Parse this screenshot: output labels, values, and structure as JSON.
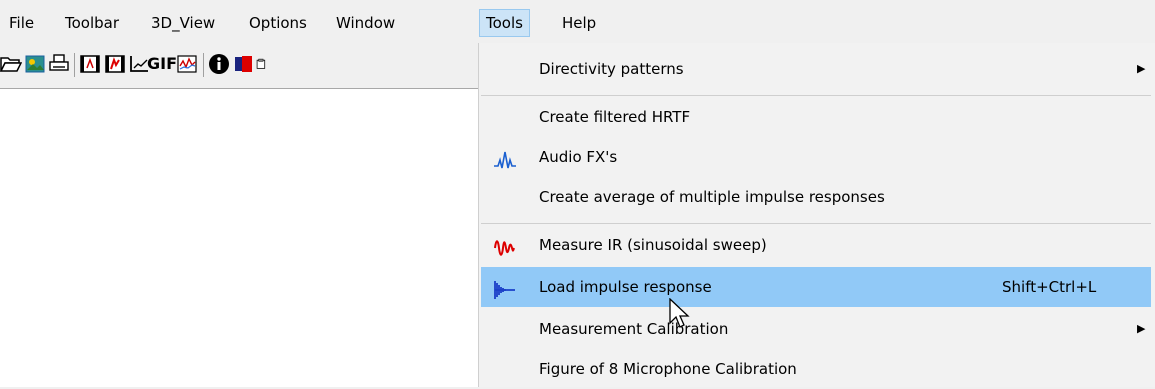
{
  "menubar": {
    "items": [
      "File",
      "Toolbar",
      "3D_View",
      "Options",
      "Window",
      "Tools",
      "Help"
    ],
    "active": "Tools"
  },
  "toolbar": {
    "icons": [
      "open-folder-icon",
      "image-icon",
      "print-icon",
      "film-icon",
      "film-red-icon",
      "chart-axis-icon",
      "gif-icon",
      "plot-icon",
      "info-icon",
      "book-icon",
      "clipboard-icon"
    ],
    "gif_label": "GIF"
  },
  "tools_menu": {
    "items": [
      {
        "label": "Directivity patterns",
        "submenu": true
      },
      {
        "label": "Create filtered HRTF"
      },
      {
        "label": "Audio FX's",
        "icon": "audio-wave-icon"
      },
      {
        "label": "Create average of multiple impulse responses"
      },
      {
        "label": "Measure IR (sinusoidal sweep)",
        "icon": "sine-sweep-icon"
      },
      {
        "label": "Load impulse response",
        "icon": "impulse-waveform-icon",
        "shortcut": "Shift+Ctrl+L",
        "highlighted": true
      },
      {
        "label": "Measurement Calibration",
        "submenu": true
      },
      {
        "label": "Figure of 8 Microphone Calibration"
      }
    ],
    "submenu_arrow": "▶"
  },
  "colors": {
    "highlight": "#91c9f7",
    "menu_active_bg": "#cce4f7",
    "menu_bg": "#f2f2f2"
  }
}
